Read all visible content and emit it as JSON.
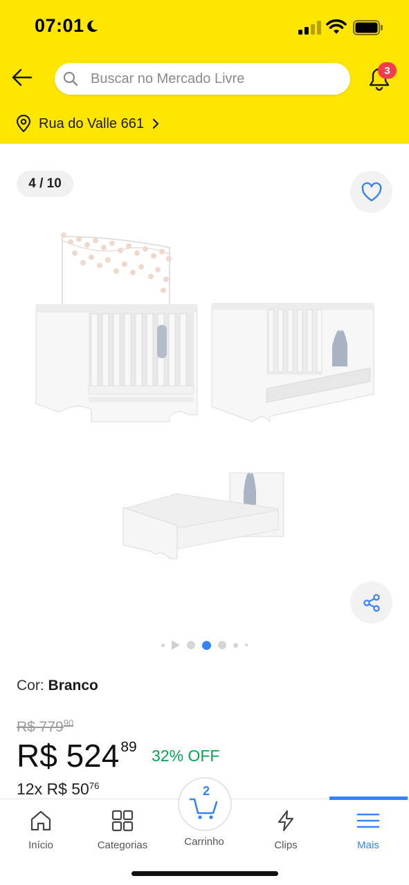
{
  "status_bar": {
    "time": "07:01"
  },
  "header": {
    "search_placeholder": "Buscar no Mercado Livre",
    "notifications_count": "3",
    "address": "Rua do Valle 661",
    "background_color": "#ffe600"
  },
  "gallery": {
    "counter": "4 / 10",
    "image_alt": "Berço mini cama branco em três configurações",
    "current_index": 3,
    "total_images": 10
  },
  "product": {
    "color_label": "Cor:",
    "color_value": "Branco",
    "old_price_main": "R$ 779",
    "old_price_cents": "90",
    "price_main": "R$ 524",
    "price_cents": "89",
    "discount": "32% OFF",
    "installments_main": "12x R$ 50",
    "installments_cents": "76",
    "discount_color": "#00a650",
    "accent_color": "#3483fa"
  },
  "tabbar": {
    "items": [
      {
        "label": "Início",
        "icon": "home-icon"
      },
      {
        "label": "Categorias",
        "icon": "grid-icon"
      },
      {
        "label": "Carrinho",
        "icon": "cart-icon",
        "count": "2"
      },
      {
        "label": "Clips",
        "icon": "lightning-icon"
      },
      {
        "label": "Mais",
        "icon": "menu-icon",
        "active": true
      }
    ]
  }
}
